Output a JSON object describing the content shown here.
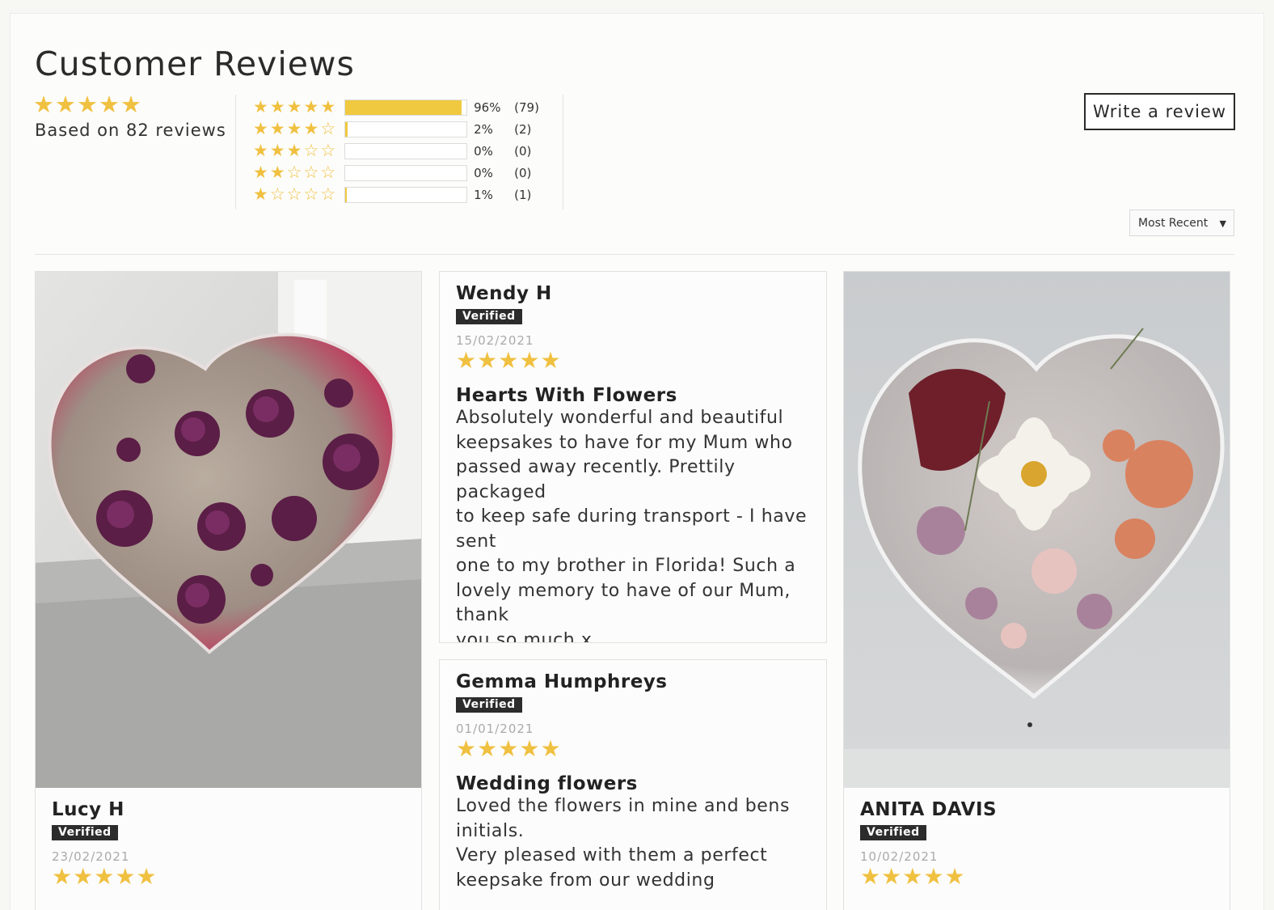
{
  "header": {
    "title": "Customer Reviews",
    "based_on": "Based on 82 reviews",
    "average_rating": 5,
    "write_review_label": "Write a review",
    "sort_label": "Most Recent"
  },
  "histogram": [
    {
      "stars": 5,
      "fill": 0.96,
      "percent": "96%",
      "count": "(79)"
    },
    {
      "stars": 4,
      "fill": 0.02,
      "percent": "2%",
      "count": "(2)"
    },
    {
      "stars": 3,
      "fill": 0.0,
      "percent": "0%",
      "count": "(0)"
    },
    {
      "stars": 2,
      "fill": 0.0,
      "percent": "0%",
      "count": "(0)"
    },
    {
      "stars": 1,
      "fill": 0.01,
      "percent": "1%",
      "count": "(1)"
    }
  ],
  "colors": {
    "star": "#f0c040",
    "bar": "#f0c940",
    "badge": "#2c2c2c"
  },
  "reviews": [
    {
      "name": "Lucy H",
      "verified": "Verified",
      "date": "23/02/2021",
      "rating": 5,
      "photo": "purple-roses-resin-heart"
    },
    {
      "name": "Wendy H",
      "verified": "Verified",
      "date": "15/02/2021",
      "rating": 5,
      "title": "Hearts With Flowers",
      "body": [
        "Absolutely wonderful and beautiful",
        "keepsakes to have for my Mum who",
        "passed away recently. Prettily packaged",
        "to keep safe during transport - I have sent",
        "one to my brother in Florida! Such a",
        "lovely memory to have of our Mum, thank",
        "you so much x"
      ],
      "share": [
        "facebook-icon",
        "twitter-icon"
      ]
    },
    {
      "name": "ANITA DAVIS",
      "verified": "Verified",
      "date": "10/02/2021",
      "rating": 5,
      "photo": "mixed-flowers-resin-heart"
    },
    {
      "name": "Gemma Humphreys",
      "verified": "Verified",
      "date": "01/01/2021",
      "rating": 5,
      "title": "Wedding flowers",
      "body": [
        "Loved the flowers in mine and bens",
        "initials.",
        "Very pleased with them a perfect",
        "keepsake from our wedding"
      ]
    }
  ]
}
